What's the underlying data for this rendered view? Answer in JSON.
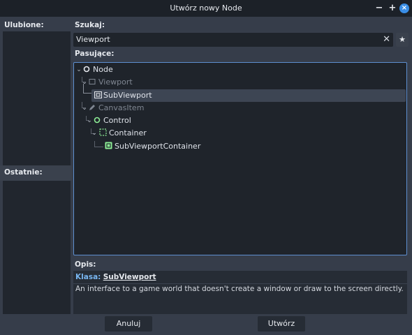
{
  "window": {
    "title": "Utwórz nowy Node",
    "minimize": "−",
    "maximize": "+",
    "close": "×"
  },
  "left": {
    "favorites_label": "Ulubione:",
    "recent_label": "Ostatnie:"
  },
  "search": {
    "label": "Szukaj:",
    "value": "Viewport",
    "clear": "✕",
    "favorite_star": "★"
  },
  "matches": {
    "label": "Pasujące:",
    "items": [
      {
        "label": "Node",
        "icon": "node-circle-icon",
        "dim": false
      },
      {
        "label": "Viewport",
        "icon": "viewport-rect-icon",
        "dim": true
      },
      {
        "label": "SubViewport",
        "icon": "subviewport-icon",
        "dim": false,
        "selected": true
      },
      {
        "label": "CanvasItem",
        "icon": "pencil-icon",
        "dim": true
      },
      {
        "label": "Control",
        "icon": "control-circle-icon",
        "dim": false
      },
      {
        "label": "Container",
        "icon": "container-dashed-icon",
        "dim": false
      },
      {
        "label": "SubViewportContainer",
        "icon": "subviewport-container-icon",
        "dim": false
      }
    ]
  },
  "description": {
    "label": "Opis:",
    "class_prefix": "Klasa:",
    "class_name": "SubViewport",
    "text": "An interface to a game world that doesn't create a window or draw to the screen directly."
  },
  "buttons": {
    "cancel": "Anuluj",
    "create": "Utwórz"
  },
  "colors": {
    "accent": "#5d8fd0",
    "green_icon": "#8eef97",
    "link_blue": "#78b5f0"
  }
}
